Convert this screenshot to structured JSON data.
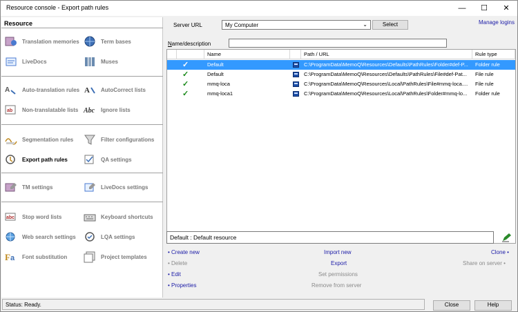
{
  "window": {
    "title": "Resource console - Export path rules",
    "minimize": "—",
    "maximize": "☐",
    "close": "✕"
  },
  "left": {
    "title": "Resource",
    "items": [
      {
        "label": "Translation memories",
        "icon": "translation-memory-icon"
      },
      {
        "label": "Term bases",
        "icon": "term-base-icon"
      },
      {
        "label": "LiveDocs",
        "icon": "livedocs-icon"
      },
      {
        "label": "Muses",
        "icon": "muses-icon"
      },
      {
        "label": "Auto-translation rules",
        "icon": "auto-translation-icon"
      },
      {
        "label": "AutoCorrect lists",
        "icon": "autocorrect-icon"
      },
      {
        "label": "Non-translatable lists",
        "icon": "non-translatable-icon"
      },
      {
        "label": "Ignore lists",
        "icon": "ignore-list-icon"
      },
      {
        "label": "Segmentation rules",
        "icon": "segmentation-icon"
      },
      {
        "label": "Filter configurations",
        "icon": "filter-icon"
      },
      {
        "label": "Export path rules",
        "icon": "export-path-icon"
      },
      {
        "label": "QA settings",
        "icon": "qa-settings-icon"
      },
      {
        "label": "TM settings",
        "icon": "tm-settings-icon"
      },
      {
        "label": "LiveDocs settings",
        "icon": "livedocs-settings-icon"
      },
      {
        "label": "Stop word lists",
        "icon": "stop-word-icon"
      },
      {
        "label": "Keyboard shortcuts",
        "icon": "keyboard-icon"
      },
      {
        "label": "Web search settings",
        "icon": "web-search-icon"
      },
      {
        "label": "LQA settings",
        "icon": "lqa-settings-icon"
      },
      {
        "label": "Font substitution",
        "icon": "font-substitution-icon"
      },
      {
        "label": "Project templates",
        "icon": "project-templates-icon"
      }
    ]
  },
  "server": {
    "label": "Server URL",
    "value": "My Computer",
    "select_label": "Select",
    "manage_logins": "Manage logins"
  },
  "filter": {
    "label": "Name/description",
    "value": ""
  },
  "grid": {
    "headers": {
      "name": "Name",
      "path": "Path / URL",
      "type": "Rule type"
    },
    "rows": [
      {
        "name": "Default",
        "path": "C:\\ProgramData\\MemoQ\\Resources\\Defaults\\PathRules\\Folder#def-P...",
        "type": "Folder rule",
        "selected": true
      },
      {
        "name": "Default",
        "path": "C:\\ProgramData\\MemoQ\\Resources\\Defaults\\PathRules\\File#def-Pat...",
        "type": "File rule",
        "selected": false
      },
      {
        "name": "mmq-loca",
        "path": "C:\\ProgramData\\MemoQ\\Resources\\Local\\PathRules\\File#mmq-loca....",
        "type": "File rule",
        "selected": false
      },
      {
        "name": "mmq-loca1",
        "path": "C:\\ProgramData\\MemoQ\\Resources\\Local\\PathRules\\Folder#mmq-lo...",
        "type": "Folder rule",
        "selected": false
      }
    ]
  },
  "description": "Default : Default resource",
  "actions": {
    "create_new": "• Create new",
    "delete": "• Delete",
    "edit": "• Edit",
    "properties": "• Properties",
    "import_new": "Import new",
    "export": "Export",
    "set_permissions": "Set permissions",
    "remove_from_server": "Remove from server",
    "clone": "Clone •",
    "share_on_server": "Share on server •"
  },
  "status": "Status: Ready.",
  "buttons": {
    "close": "Close",
    "help": "Help"
  },
  "colors": {
    "selection": "#3399ff",
    "link": "#1a1aa6",
    "disabled": "#8a8a8a",
    "check": "#1a8a1a"
  }
}
